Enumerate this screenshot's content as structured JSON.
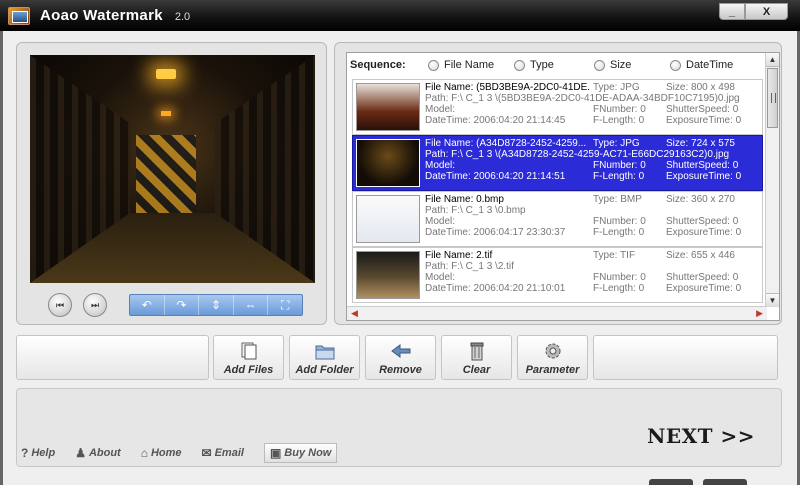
{
  "window": {
    "title": "Aoao Watermark",
    "version": "2.0",
    "min_label": "_",
    "close_label": "X"
  },
  "preview": {
    "prev_icon": "skip-back-icon",
    "next_icon": "skip-forward-icon",
    "tools": [
      "undo-icon",
      "redo-icon",
      "flip-vertical-icon",
      "flip-horizontal-icon",
      "fit-icon"
    ]
  },
  "list": {
    "sequence_label": "Sequence:",
    "sort_options": [
      "File Name",
      "Type",
      "Size",
      "DateTime"
    ],
    "files": [
      {
        "name": "File Name: (5BD3BE9A-2DC0-41DE.",
        "type": "Type: JPG",
        "size": "Size: 800 x 498",
        "path": "Path: F:\\ C_1 3 \\(5BD3BE9A-2DC0-41DE-ADAA-34BDF10C7195)0.jpg",
        "model": "Model:",
        "fnumber": "FNumber: 0",
        "shutter": "ShutterSpeed: 0",
        "datetime": "DateTime: 2006:04:20 21:14:45",
        "flength": "F-Length: 0",
        "exposure": "ExposureTime: 0",
        "selected": false
      },
      {
        "name": "File Name: (A34D8728-2452-4259...",
        "type": "Type: JPG",
        "size": "Size: 724 x 575",
        "path": "Path: F:\\ C_1 3 \\(A34D8728-2452-4259-AC71-E66DC29163C2)0.jpg",
        "model": "Model:",
        "fnumber": "FNumber: 0",
        "shutter": "ShutterSpeed: 0",
        "datetime": "DateTime: 2006:04:20 21:14:51",
        "flength": "F-Length: 0",
        "exposure": "ExposureTime: 0",
        "selected": true
      },
      {
        "name": "File Name: 0.bmp",
        "type": "Type: BMP",
        "size": "Size: 360 x 270",
        "path": "Path: F:\\ C_1 3 \\0.bmp",
        "model": "Model:",
        "fnumber": "FNumber: 0",
        "shutter": "ShutterSpeed: 0",
        "datetime": "DateTime: 2006:04:17 23:30:37",
        "flength": "F-Length: 0",
        "exposure": "ExposureTime: 0",
        "selected": false
      },
      {
        "name": "File Name: 2.tif",
        "type": "Type: TIF",
        "size": "Size: 655 x 446",
        "path": "Path: F:\\ C_1 3 \\2.tif",
        "model": "Model:",
        "fnumber": "FNumber: 0",
        "shutter": "ShutterSpeed: 0",
        "datetime": "DateTime: 2006:04:20 21:10:01",
        "flength": "F-Length: 0",
        "exposure": "ExposureTime: 0",
        "selected": false
      }
    ]
  },
  "actions": {
    "add_files": "Add Files",
    "add_folder": "Add Folder",
    "remove": "Remove",
    "clear": "Clear",
    "parameter": "Parameter"
  },
  "footer": {
    "help": "Help",
    "about": "About",
    "home": "Home",
    "email": "Email",
    "buy_now": "Buy Now",
    "next": "NEXT >>"
  },
  "colors": {
    "selection": "#2b2bd8",
    "tool_strip": "#7aa6de"
  }
}
